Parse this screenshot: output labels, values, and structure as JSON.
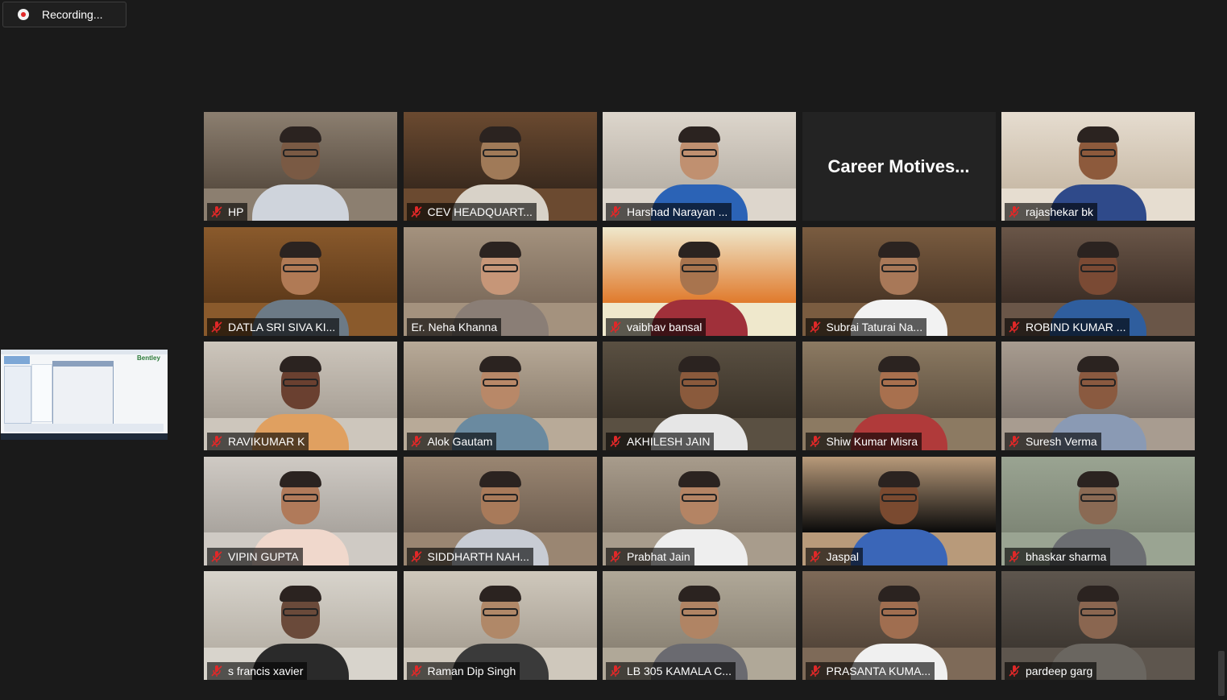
{
  "recording": {
    "label": "Recording..."
  },
  "share_thumb": {
    "brand": "Bentley"
  },
  "tiles": [
    {
      "name": "HP",
      "muted": true
    },
    {
      "name": "CEV HEADQUART...",
      "muted": true
    },
    {
      "name": "Harshad Narayan ...",
      "muted": true
    },
    {
      "name": "Career  Motives...",
      "muted": false,
      "text_only": true
    },
    {
      "name": "rajashekar bk",
      "muted": true
    },
    {
      "name": "DATLA SRI SIVA KI...",
      "muted": true
    },
    {
      "name": "Er. Neha Khanna",
      "muted": false,
      "active": true
    },
    {
      "name": "vaibhav bansal",
      "muted": true
    },
    {
      "name": "Subrai Taturai Na...",
      "muted": true
    },
    {
      "name": "ROBIND KUMAR ...",
      "muted": true
    },
    {
      "name": "RAVIKUMAR K",
      "muted": true
    },
    {
      "name": "Alok Gautam",
      "muted": true
    },
    {
      "name": "AKHILESH JAIN",
      "muted": true
    },
    {
      "name": "Shiw Kumar Misra",
      "muted": true
    },
    {
      "name": "Suresh Verma",
      "muted": true
    },
    {
      "name": "VIPIN GUPTA",
      "muted": true
    },
    {
      "name": "SIDDHARTH NAH...",
      "muted": true
    },
    {
      "name": "Prabhat Jain",
      "muted": true
    },
    {
      "name": "Jaspal",
      "muted": true
    },
    {
      "name": "bhaskar sharma",
      "muted": true
    },
    {
      "name": "s francis xavier",
      "muted": true
    },
    {
      "name": "Raman Dip Singh",
      "muted": true
    },
    {
      "name": "LB 305 KAMALA C...",
      "muted": true
    },
    {
      "name": "PRASANTA KUMA...",
      "muted": true
    },
    {
      "name": "pardeep garg",
      "muted": true
    }
  ],
  "icons": {
    "muted": "mic-off-icon",
    "recording": "record-icon"
  },
  "colors": {
    "background": "#1a1a1a",
    "active_speaker": "#c6e548",
    "muted": "#e02828"
  }
}
